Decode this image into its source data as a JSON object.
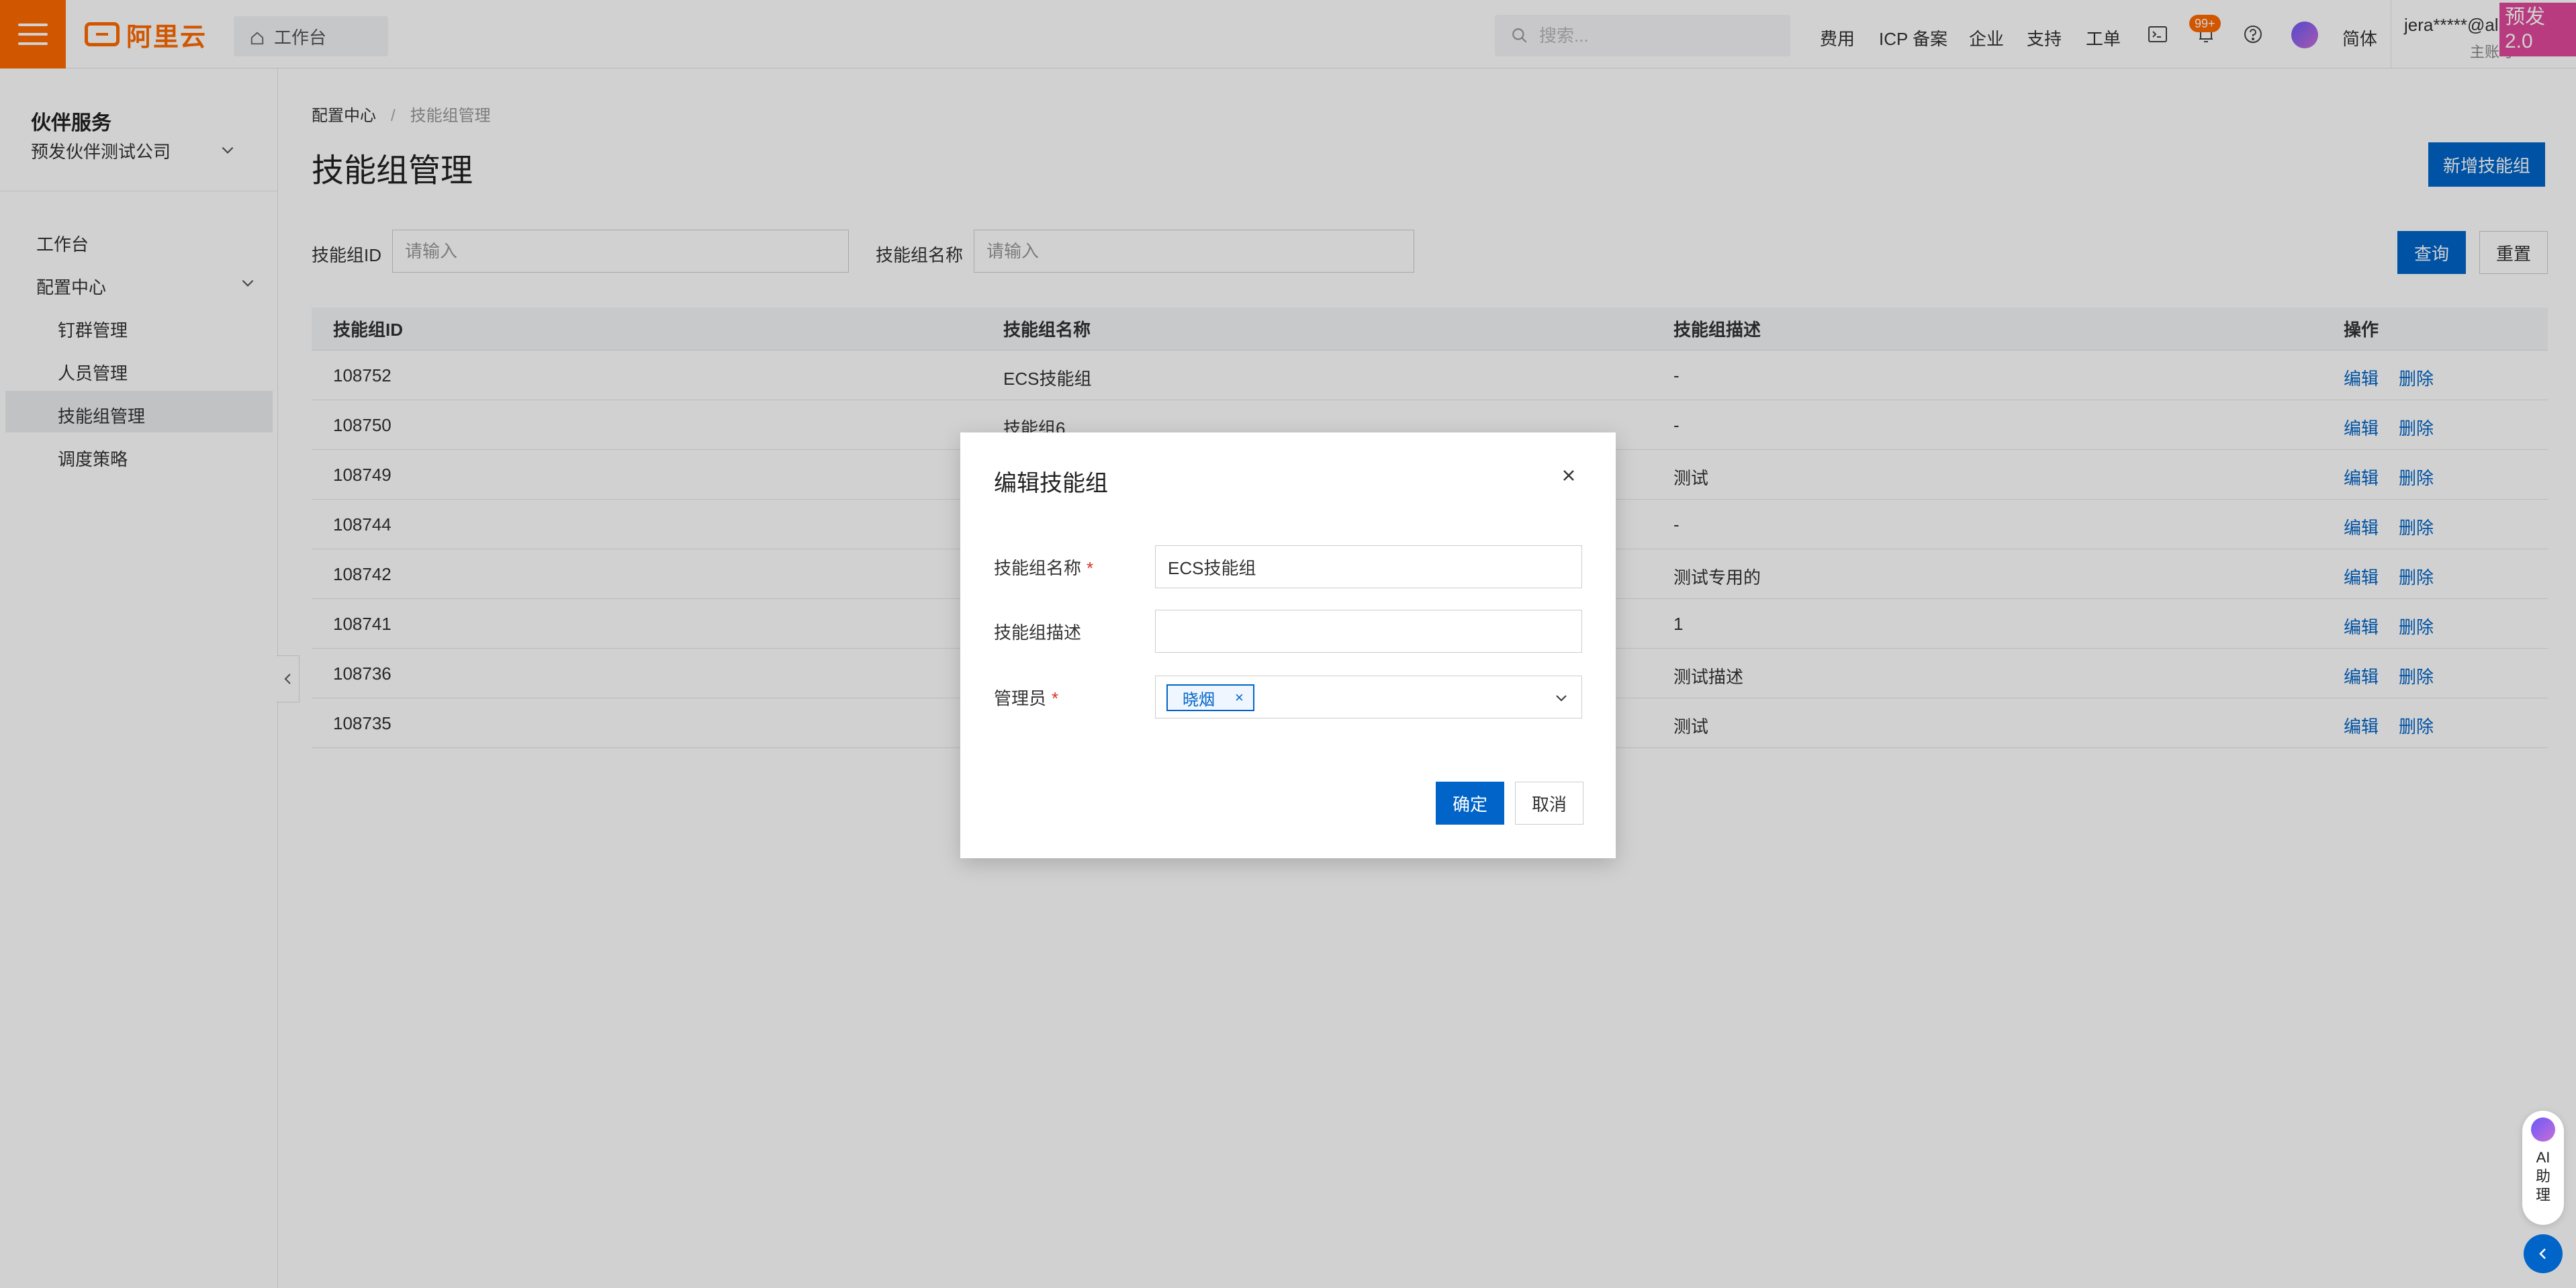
{
  "topbar": {
    "logo_text": "阿里云",
    "workbench_tab": "工作台",
    "search_placeholder": "搜索...",
    "links": [
      "费用",
      "ICP 备案",
      "企业",
      "支持",
      "工单"
    ],
    "notification_count": "99+",
    "language": "简体",
    "account_name": "jera*****@al",
    "account_type": "主账号",
    "env_badge": "预发2.0"
  },
  "sidebar": {
    "title": "伙伴服务",
    "company": "预发伙伴测试公司",
    "items": {
      "workbench": "工作台",
      "config_center": "配置中心",
      "dingtalk_groups": "钉群管理",
      "staff": "人员管理",
      "skill_groups": "技能组管理",
      "dispatch": "调度策略"
    }
  },
  "main": {
    "breadcrumb": {
      "parent": "配置中心",
      "current": "技能组管理"
    },
    "title": "技能组管理",
    "new_button": "新增技能组",
    "filters": {
      "id_label": "技能组ID",
      "id_placeholder": "请输入",
      "name_label": "技能组名称",
      "name_placeholder": "请输入",
      "query_button": "查询",
      "reset_button": "重置"
    },
    "table": {
      "headers": [
        "技能组ID",
        "技能组名称",
        "技能组描述",
        "操作"
      ],
      "edit_label": "编辑",
      "delete_label": "删除",
      "rows": [
        {
          "id": "108752",
          "name": "ECS技能组",
          "desc": "-"
        },
        {
          "id": "108750",
          "name": "技能组6",
          "desc": "-"
        },
        {
          "id": "108749",
          "name": "",
          "desc": "测试"
        },
        {
          "id": "108744",
          "name": "",
          "desc": "-"
        },
        {
          "id": "108742",
          "name": "",
          "desc": "测试专用的"
        },
        {
          "id": "108741",
          "name": "",
          "desc": "1"
        },
        {
          "id": "108736",
          "name": "",
          "desc": "测试描述"
        },
        {
          "id": "108735",
          "name": "",
          "desc": "测试"
        }
      ]
    }
  },
  "modal": {
    "title": "编辑技能组",
    "name_label": "技能组名称",
    "name_value": "ECS技能组",
    "desc_label": "技能组描述",
    "desc_value": "",
    "admin_label": "管理员",
    "admin_tag": "晓烟",
    "ok_button": "确定",
    "cancel_button": "取消"
  },
  "ai_assistant": {
    "label_line1": "AI",
    "label_line2": "助",
    "label_line3": "理"
  },
  "colors": {
    "brand_orange": "#ff6a00",
    "primary_blue": "#0064c8",
    "required_red": "#d93026",
    "env_badge_pink": "#e0489a"
  }
}
